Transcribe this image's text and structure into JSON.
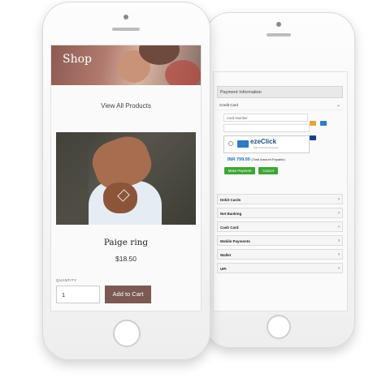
{
  "front": {
    "hero_title": "Shop",
    "view_all": "View All Products",
    "product": {
      "name": "Paige ring",
      "price": "$18.50"
    },
    "quantity": {
      "label": "QUANTITY",
      "value": "1"
    },
    "add_to_cart": "Add to Cart"
  },
  "back": {
    "header": "Payment Information",
    "credit_card": {
      "label": "Credit Card",
      "card_number_placeholder": "Card Number",
      "ezclick_brand": "ezeClick",
      "ezclick_sub": "with American Express",
      "amount": "INR 799.00",
      "amount_note": "(Total Amount Payable)",
      "make_payment": "Make Payment",
      "cancel": "Cancel"
    },
    "methods": [
      "Debit Cards",
      "Net Banking",
      "Cash Card",
      "Mobile Payments",
      "Wallet",
      "UPI"
    ]
  },
  "colors": {
    "accent_brown": "#7a5a52",
    "pay_green": "#3fa535",
    "amount_blue": "#1e73b8"
  },
  "icons": [
    "visa-icon",
    "mastercard-icon",
    "amex-icon",
    "chevron-down-icon",
    "chevron-right-icon"
  ]
}
